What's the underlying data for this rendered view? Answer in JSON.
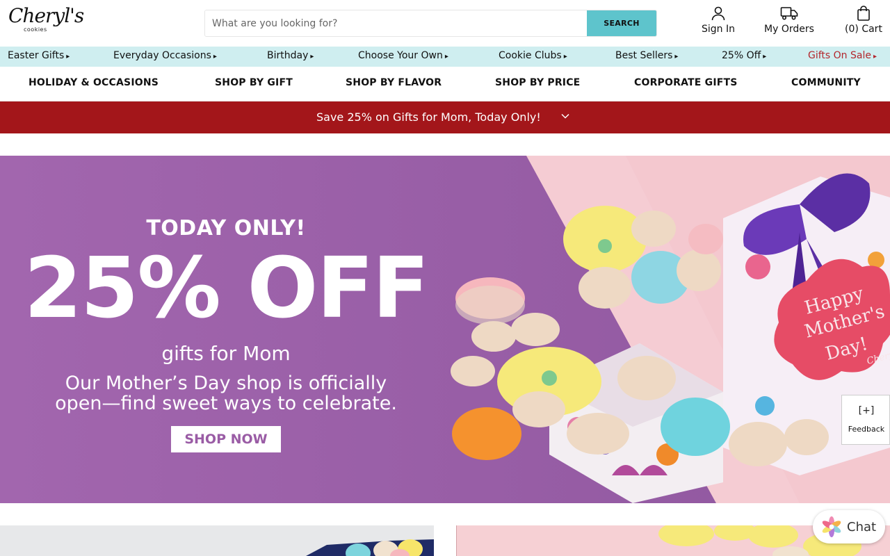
{
  "header": {
    "logo_text": "Cheryl's",
    "logo_sub": "cookies",
    "search_placeholder": "What are you looking for?",
    "search_button": "SEARCH",
    "sign_in": "Sign In",
    "my_orders": "My Orders",
    "cart": "(0) Cart"
  },
  "quick_nav": [
    {
      "label": "Easter Gifts",
      "arrow": "▸"
    },
    {
      "label": "Everyday Occasions",
      "arrow": "▸"
    },
    {
      "label": "Birthday",
      "arrow": "▸"
    },
    {
      "label": "Choose Your Own",
      "arrow": "▸"
    },
    {
      "label": "Cookie Clubs",
      "arrow": "▸"
    },
    {
      "label": "Best Sellers",
      "arrow": "▸"
    },
    {
      "label": "25% Off",
      "arrow": "▸"
    },
    {
      "label": "Gifts On Sale",
      "arrow": "▸"
    }
  ],
  "main_nav": [
    "HOLIDAY & OCCASIONS",
    "SHOP BY GIFT",
    "SHOP BY FLAVOR",
    "SHOP BY PRICE",
    "CORPORATE GIFTS",
    "COMMUNITY"
  ],
  "promo": {
    "text": "Save 25% on Gifts for Mom, Today Only!"
  },
  "hero": {
    "eyebrow": "TODAY ONLY!",
    "headline": "25% OFF",
    "subheadline": "gifts for Mom",
    "desc_line1": "Our Mother’s Day shop is officially",
    "desc_line2": "open—find sweet ways to celebrate.",
    "cta": "SHOP NOW",
    "tag_line1": "Happy",
    "tag_line2": "Mother's",
    "tag_line3": "Day!",
    "tag_brand": "Cheryl's"
  },
  "feedback": {
    "icon": "[+]",
    "label": "Feedback"
  },
  "chat": {
    "label": "Chat"
  },
  "colors": {
    "accent_teal": "#5ec4cc",
    "quicknav_bg": "#cfeef0",
    "promo_red": "#a3161a",
    "hero_purple": "#9a5ca5",
    "hero_pink": "#f3c9cf",
    "sale_red": "#b3262c"
  }
}
